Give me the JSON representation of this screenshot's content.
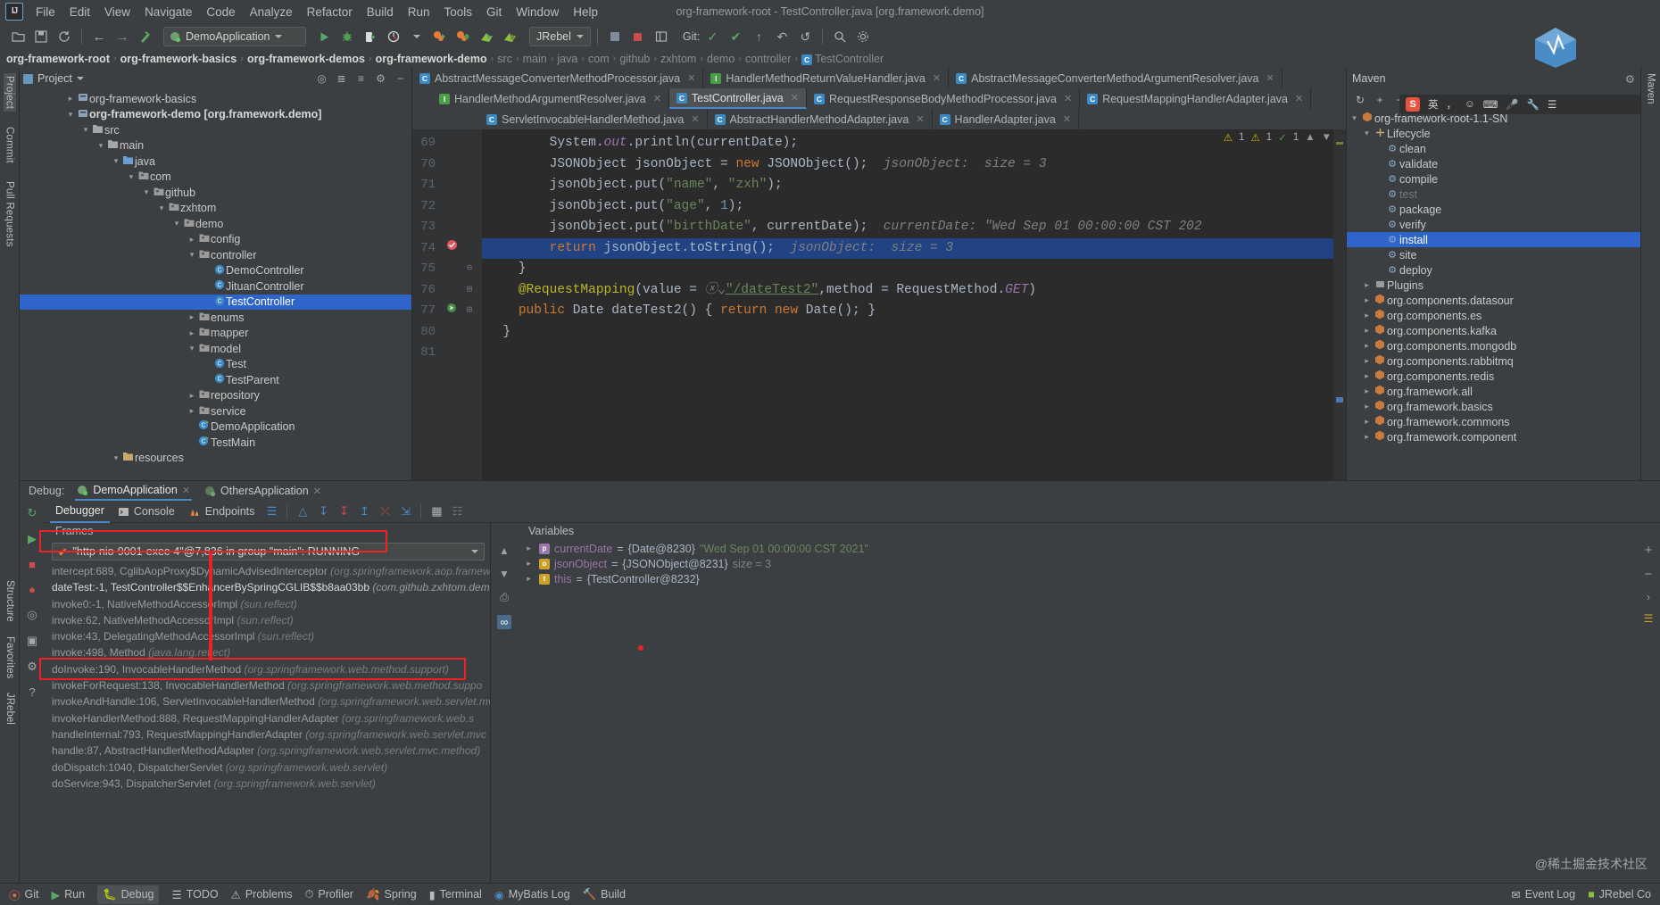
{
  "window": {
    "title": "org-framework-root - TestController.java [org.framework.demo]"
  },
  "menubar": {
    "logo": "IJ",
    "items": [
      "File",
      "Edit",
      "View",
      "Navigate",
      "Code",
      "Analyze",
      "Refactor",
      "Build",
      "Run",
      "Tools",
      "Git",
      "Window",
      "Help"
    ]
  },
  "toolbar": {
    "icons": [
      "open-folder-icon",
      "save-icon",
      "sync-icon"
    ],
    "nav_back": "←",
    "nav_forward": "→",
    "run_config": "DemoApplication",
    "run_icon": "run-icon",
    "debug_icon": "debug-icon",
    "run_coverage_icon": "run-with-coverage-icon",
    "profiler_icon": "profiler-icon",
    "jrebel_label": "JRebel",
    "git_label": "Git:",
    "search_icon": "search-icon"
  },
  "breadcrumb": {
    "items": [
      {
        "label": "org-framework-root",
        "bold": true
      },
      {
        "label": "org-framework-basics",
        "bold": true
      },
      {
        "label": "org-framework-demos",
        "bold": true
      },
      {
        "label": "org-framework-demo",
        "bold": true
      },
      {
        "label": "src",
        "bold": false
      },
      {
        "label": "main",
        "bold": false
      },
      {
        "label": "java",
        "bold": false
      },
      {
        "label": "com",
        "bold": false
      },
      {
        "label": "github",
        "bold": false
      },
      {
        "label": "zxhtom",
        "bold": false
      },
      {
        "label": "demo",
        "bold": false
      },
      {
        "label": "controller",
        "bold": false
      },
      {
        "label": "TestController",
        "bold": false
      }
    ]
  },
  "left_strip": {
    "items": [
      "Project",
      "Commit",
      "Pull Requests",
      "Structure",
      "Favorites",
      "JRebel"
    ]
  },
  "project": {
    "title": "Project",
    "tree": [
      {
        "depth": 3,
        "arrow": "›",
        "icon": "module-icon",
        "label": "org-framework-basics",
        "bold": false
      },
      {
        "depth": 3,
        "arrow": "⌄",
        "icon": "module-icon",
        "label": "org-framework-demo [org.framework.demo]",
        "bold": true
      },
      {
        "depth": 4,
        "arrow": "⌄",
        "icon": "folder-icon",
        "label": "src",
        "bold": false
      },
      {
        "depth": 5,
        "arrow": "⌄",
        "icon": "folder-icon",
        "label": "main",
        "bold": false
      },
      {
        "depth": 6,
        "arrow": "⌄",
        "icon": "source-folder-icon",
        "label": "java",
        "bold": false
      },
      {
        "depth": 7,
        "arrow": "⌄",
        "icon": "package-icon",
        "label": "com",
        "bold": false
      },
      {
        "depth": 8,
        "arrow": "⌄",
        "icon": "package-icon",
        "label": "github",
        "bold": false
      },
      {
        "depth": 9,
        "arrow": "⌄",
        "icon": "package-icon",
        "label": "zxhtom",
        "bold": false
      },
      {
        "depth": 10,
        "arrow": "⌄",
        "icon": "package-icon",
        "label": "demo",
        "bold": false
      },
      {
        "depth": 11,
        "arrow": "›",
        "icon": "package-icon",
        "label": "config",
        "bold": false
      },
      {
        "depth": 11,
        "arrow": "⌄",
        "icon": "package-icon",
        "label": "controller",
        "bold": false
      },
      {
        "depth": 12,
        "arrow": "",
        "icon": "class-icon",
        "label": "DemoController",
        "bold": false
      },
      {
        "depth": 12,
        "arrow": "",
        "icon": "class-icon",
        "label": "JituanController",
        "bold": false
      },
      {
        "depth": 12,
        "arrow": "",
        "icon": "class-icon",
        "label": "TestController",
        "bold": false,
        "selected": true
      },
      {
        "depth": 11,
        "arrow": "›",
        "icon": "package-icon",
        "label": "enums",
        "bold": false
      },
      {
        "depth": 11,
        "arrow": "›",
        "icon": "package-icon",
        "label": "mapper",
        "bold": false
      },
      {
        "depth": 11,
        "arrow": "⌄",
        "icon": "package-icon",
        "label": "model",
        "bold": false
      },
      {
        "depth": 12,
        "arrow": "",
        "icon": "class-icon",
        "label": "Test",
        "bold": false
      },
      {
        "depth": 12,
        "arrow": "",
        "icon": "class-icon",
        "label": "TestParent",
        "bold": false
      },
      {
        "depth": 11,
        "arrow": "›",
        "icon": "package-icon",
        "label": "repository",
        "bold": false
      },
      {
        "depth": 11,
        "arrow": "›",
        "icon": "package-icon",
        "label": "service",
        "bold": false
      },
      {
        "depth": 11,
        "arrow": "",
        "icon": "spring-class-icon",
        "label": "DemoApplication",
        "bold": false
      },
      {
        "depth": 11,
        "arrow": "",
        "icon": "runnable-class-icon",
        "label": "TestMain",
        "bold": false
      },
      {
        "depth": 6,
        "arrow": "⌄",
        "icon": "resources-folder-icon",
        "label": "resources",
        "bold": false
      }
    ]
  },
  "editor": {
    "tab_rows": [
      [
        {
          "label": "AbstractMessageConverterMethodProcessor.java",
          "icon": "class-icon",
          "active": false
        },
        {
          "label": "HandlerMethodReturnValueHandler.java",
          "icon": "interface-icon",
          "active": false
        },
        {
          "label": "AbstractMessageConverterMethodArgumentResolver.java",
          "icon": "class-icon",
          "active": false
        }
      ],
      [
        {
          "label": "HandlerMethodArgumentResolver.java",
          "icon": "interface-icon",
          "active": false
        },
        {
          "label": "TestController.java",
          "icon": "class-icon",
          "active": true
        },
        {
          "label": "RequestResponseBodyMethodProcessor.java",
          "icon": "class-icon",
          "active": false
        },
        {
          "label": "RequestMappingHandlerAdapter.java",
          "icon": "class-icon",
          "active": false
        }
      ],
      [
        {
          "label": "ServletInvocableHandlerMethod.java",
          "icon": "class-icon",
          "active": false
        },
        {
          "label": "AbstractHandlerMethodAdapter.java",
          "icon": "class-icon",
          "active": false
        },
        {
          "label": "HandlerAdapter.java",
          "icon": "class-icon",
          "active": false
        }
      ]
    ],
    "inspection": {
      "warnings": "1",
      "weak_warnings": "1",
      "errors": "1"
    },
    "lines": [
      {
        "num": "69",
        "mark": "",
        "fold": "",
        "html": "        System.<i class=\"f\">out</i>.println(currentDate);",
        "hl": false
      },
      {
        "num": "70",
        "mark": "",
        "fold": "",
        "html": "        JSONObject jsonObject = <span class=\"k\">new</span> JSONObject();  <span class=\"hint\">jsonObject:  size = 3</span>",
        "hl": false
      },
      {
        "num": "71",
        "mark": "",
        "fold": "",
        "html": "        jsonObject.put(<span class=\"s\">\"name\"</span>, <span class=\"s\">\"zxh\"</span>);",
        "hl": false
      },
      {
        "num": "72",
        "mark": "",
        "fold": "",
        "html": "        jsonObject.put(<span class=\"s\">\"age\"</span>, <span class=\"n\">1</span>);",
        "hl": false
      },
      {
        "num": "73",
        "mark": "",
        "fold": "",
        "html": "        jsonObject.put(<span class=\"s\">\"birthDate\"</span>, currentDate);  <span class=\"hint\">currentDate: \"Wed Sep 01 00:00:00 CST 202</span>",
        "hl": false
      },
      {
        "num": "74",
        "mark": "breakpoint-icon",
        "fold": "",
        "html": "        <span class=\"k\">return</span> jsonObject.toString();  <span class=\"hint\">jsonObject:  size = 3</span>",
        "hl": true
      },
      {
        "num": "75",
        "mark": "",
        "fold": "⊖",
        "html": "    }",
        "hl": false
      },
      {
        "num": "76",
        "mark": "",
        "fold": "⊞",
        "html": "    <span class=\"an\">@RequestMapping</span>(value = <span class=\"hint\">ⓧ⌄</span><span class=\"lnk\">\"/dateTest2\"</span>,method = RequestMethod.<i class=\"f\">GET</i>)",
        "hl": false
      },
      {
        "num": "77",
        "mark": "gutter-run-icon",
        "fold": "⊞",
        "html": "    <span class=\"k\">public</span> Date dateTest2() { <span class=\"k\">return</span> <span class=\"k\">new</span> Date(); }",
        "hl": false
      },
      {
        "num": "80",
        "mark": "",
        "fold": "",
        "html": "  }",
        "hl": false
      },
      {
        "num": "81",
        "mark": "",
        "fold": "",
        "html": "",
        "hl": false
      }
    ]
  },
  "maven": {
    "title": "Maven",
    "tree": [
      {
        "depth": 0,
        "arrow": "⌄",
        "icon": "maven-module-icon",
        "label": "org-framework-root-1.1-SN",
        "dim": false
      },
      {
        "depth": 1,
        "arrow": "⌄",
        "icon": "lifecycle-icon",
        "label": "Lifecycle",
        "dim": false
      },
      {
        "depth": 2,
        "arrow": "",
        "icon": "goal-icon",
        "label": "clean",
        "dim": false
      },
      {
        "depth": 2,
        "arrow": "",
        "icon": "goal-icon",
        "label": "validate",
        "dim": false
      },
      {
        "depth": 2,
        "arrow": "",
        "icon": "goal-icon",
        "label": "compile",
        "dim": false
      },
      {
        "depth": 2,
        "arrow": "",
        "icon": "goal-icon",
        "label": "test",
        "dim": true
      },
      {
        "depth": 2,
        "arrow": "",
        "icon": "goal-icon",
        "label": "package",
        "dim": false
      },
      {
        "depth": 2,
        "arrow": "",
        "icon": "goal-icon",
        "label": "verify",
        "dim": false
      },
      {
        "depth": 2,
        "arrow": "",
        "icon": "goal-icon",
        "label": "install",
        "dim": false,
        "selected": true
      },
      {
        "depth": 2,
        "arrow": "",
        "icon": "goal-icon",
        "label": "site",
        "dim": false
      },
      {
        "depth": 2,
        "arrow": "",
        "icon": "goal-icon",
        "label": "deploy",
        "dim": false
      },
      {
        "depth": 1,
        "arrow": "›",
        "icon": "plugins-icon",
        "label": "Plugins",
        "dim": false
      },
      {
        "depth": 1,
        "arrow": "›",
        "icon": "maven-module-icon",
        "label": "org.components.datasour",
        "dim": false
      },
      {
        "depth": 1,
        "arrow": "›",
        "icon": "maven-module-icon",
        "label": "org.components.es",
        "dim": false
      },
      {
        "depth": 1,
        "arrow": "›",
        "icon": "maven-module-icon",
        "label": "org.components.kafka",
        "dim": false
      },
      {
        "depth": 1,
        "arrow": "›",
        "icon": "maven-module-icon",
        "label": "org.components.mongodb",
        "dim": false
      },
      {
        "depth": 1,
        "arrow": "›",
        "icon": "maven-module-icon",
        "label": "org.components.rabbitmq",
        "dim": false
      },
      {
        "depth": 1,
        "arrow": "›",
        "icon": "maven-module-icon",
        "label": "org.components.redis",
        "dim": false
      },
      {
        "depth": 1,
        "arrow": "›",
        "icon": "maven-module-icon",
        "label": "org.framework.all",
        "dim": false
      },
      {
        "depth": 1,
        "arrow": "›",
        "icon": "maven-module-icon",
        "label": "org.framework.basics",
        "dim": false
      },
      {
        "depth": 1,
        "arrow": "›",
        "icon": "maven-module-icon",
        "label": "org.framework.commons",
        "dim": false
      },
      {
        "depth": 1,
        "arrow": "›",
        "icon": "maven-module-icon",
        "label": "org.framework.component",
        "dim": false
      }
    ]
  },
  "ime": {
    "lang": "英",
    "s_badge": "S"
  },
  "debug": {
    "label": "Debug:",
    "sessions": [
      {
        "label": "DemoApplication",
        "active": true
      },
      {
        "label": "OthersApplication",
        "active": false
      }
    ],
    "tabs": [
      {
        "label": "Debugger",
        "active": true,
        "icon": ""
      },
      {
        "label": "Console",
        "active": false,
        "icon": "console-icon"
      },
      {
        "label": "Endpoints",
        "active": false,
        "icon": "endpoints-icon"
      }
    ],
    "toolbar_icons": [
      "layout-icon",
      "show-execution-point-icon",
      "step-over-icon",
      "step-into-icon",
      "step-out-icon",
      "force-step-into-icon",
      "run-to-cursor-icon",
      "evaluate-icon",
      "mute-breakpoints-icon"
    ],
    "side_icons": [
      "rerun-icon",
      "resume-icon",
      "stop-icon",
      "breakpoints-icon",
      "mute-icon",
      "camera-icon",
      "settings-icon",
      "help-icon"
    ],
    "frames_title": "Frames",
    "thread": "\"http-nio-9001-exec-4\"@7,836 in group \"main\": RUNNING",
    "frames": [
      {
        "method": "intercept:689, CglibAopProxy$DynamicAdvisedInterceptor",
        "pkg": "(org.springframework.aop.framew",
        "current": false
      },
      {
        "method": "dateTest:-1, TestController$$EnhancerBySpringCGLIB$$b8aa03bb",
        "pkg": "(com.github.zxhtom.dem",
        "current": true
      },
      {
        "method": "invoke0:-1, NativeMethodAccessorImpl",
        "pkg": "(sun.reflect)",
        "current": false
      },
      {
        "method": "invoke:62, NativeMethodAccessorImpl",
        "pkg": "(sun.reflect)",
        "current": false
      },
      {
        "method": "invoke:43, DelegatingMethodAccessorImpl",
        "pkg": "(sun.reflect)",
        "current": false
      },
      {
        "method": "invoke:498, Method",
        "pkg": "(java.lang.reflect)",
        "current": false
      },
      {
        "method": "doInvoke:190, InvocableHandlerMethod",
        "pkg": "(org.springframework.web.method.support)",
        "current": false
      },
      {
        "method": "invokeForRequest:138, InvocableHandlerMethod",
        "pkg": "(org.springframework.web.method.suppo",
        "current": false
      },
      {
        "method": "invokeAndHandle:106, ServletInvocableHandlerMethod",
        "pkg": "(org.springframework.web.servlet.mvc.method.annotation)",
        "current": false
      },
      {
        "method": "invokeHandlerMethod:888, RequestMappingHandlerAdapter",
        "pkg": "(org.springframework.web.s",
        "current": false
      },
      {
        "method": "handleInternal:793, RequestMappingHandlerAdapter",
        "pkg": "(org.springframework.web.servlet.mvc",
        "current": false
      },
      {
        "method": "handle:87, AbstractHandlerMethodAdapter",
        "pkg": "(org.springframework.web.servlet.mvc.method)",
        "current": false
      },
      {
        "method": "doDispatch:1040, DispatcherServlet",
        "pkg": "(org.springframework.web.servlet)",
        "current": false
      },
      {
        "method": "doService:943, DispatcherServlet",
        "pkg": "(org.springframework.web.servlet)",
        "current": false
      }
    ],
    "variables_title": "Variables",
    "variables": [
      {
        "badge": "p",
        "name": "currentDate",
        "eq": " = ",
        "type": "{Date@8230}",
        "value": "\"Wed Sep 01 00:00:00 CST 2021\"",
        "arrow": "›"
      },
      {
        "badge": "o",
        "name": "jsonObject",
        "eq": " = ",
        "type": "{JSONObject@8231}",
        "value": "size = 3",
        "arrow": "›"
      },
      {
        "badge": "t",
        "name": "this",
        "eq": " = ",
        "type": "{TestController@8232}",
        "value": "",
        "arrow": "›"
      }
    ]
  },
  "statusbar": {
    "left": [
      {
        "label": "Git",
        "icon": "git-icon",
        "active": false
      },
      {
        "label": "Run",
        "icon": "run-icon",
        "active": false
      },
      {
        "label": "Debug",
        "icon": "debug-icon",
        "active": true
      },
      {
        "label": "TODO",
        "icon": "todo-icon",
        "active": false
      },
      {
        "label": "Problems",
        "icon": "problems-icon",
        "active": false
      },
      {
        "label": "Profiler",
        "icon": "profiler-icon",
        "active": false
      },
      {
        "label": "Spring",
        "icon": "spring-icon",
        "active": false
      },
      {
        "label": "Terminal",
        "icon": "terminal-icon",
        "active": false
      },
      {
        "label": "MyBatis Log",
        "icon": "mybatis-icon",
        "active": false
      },
      {
        "label": "Build",
        "icon": "build-icon",
        "active": false
      }
    ],
    "right": [
      {
        "label": "Event Log",
        "icon": "event-log-icon"
      },
      {
        "label": "JRebel Co",
        "icon": "jrebel-icon"
      }
    ]
  },
  "watermark": "@稀土掘金技术社区"
}
